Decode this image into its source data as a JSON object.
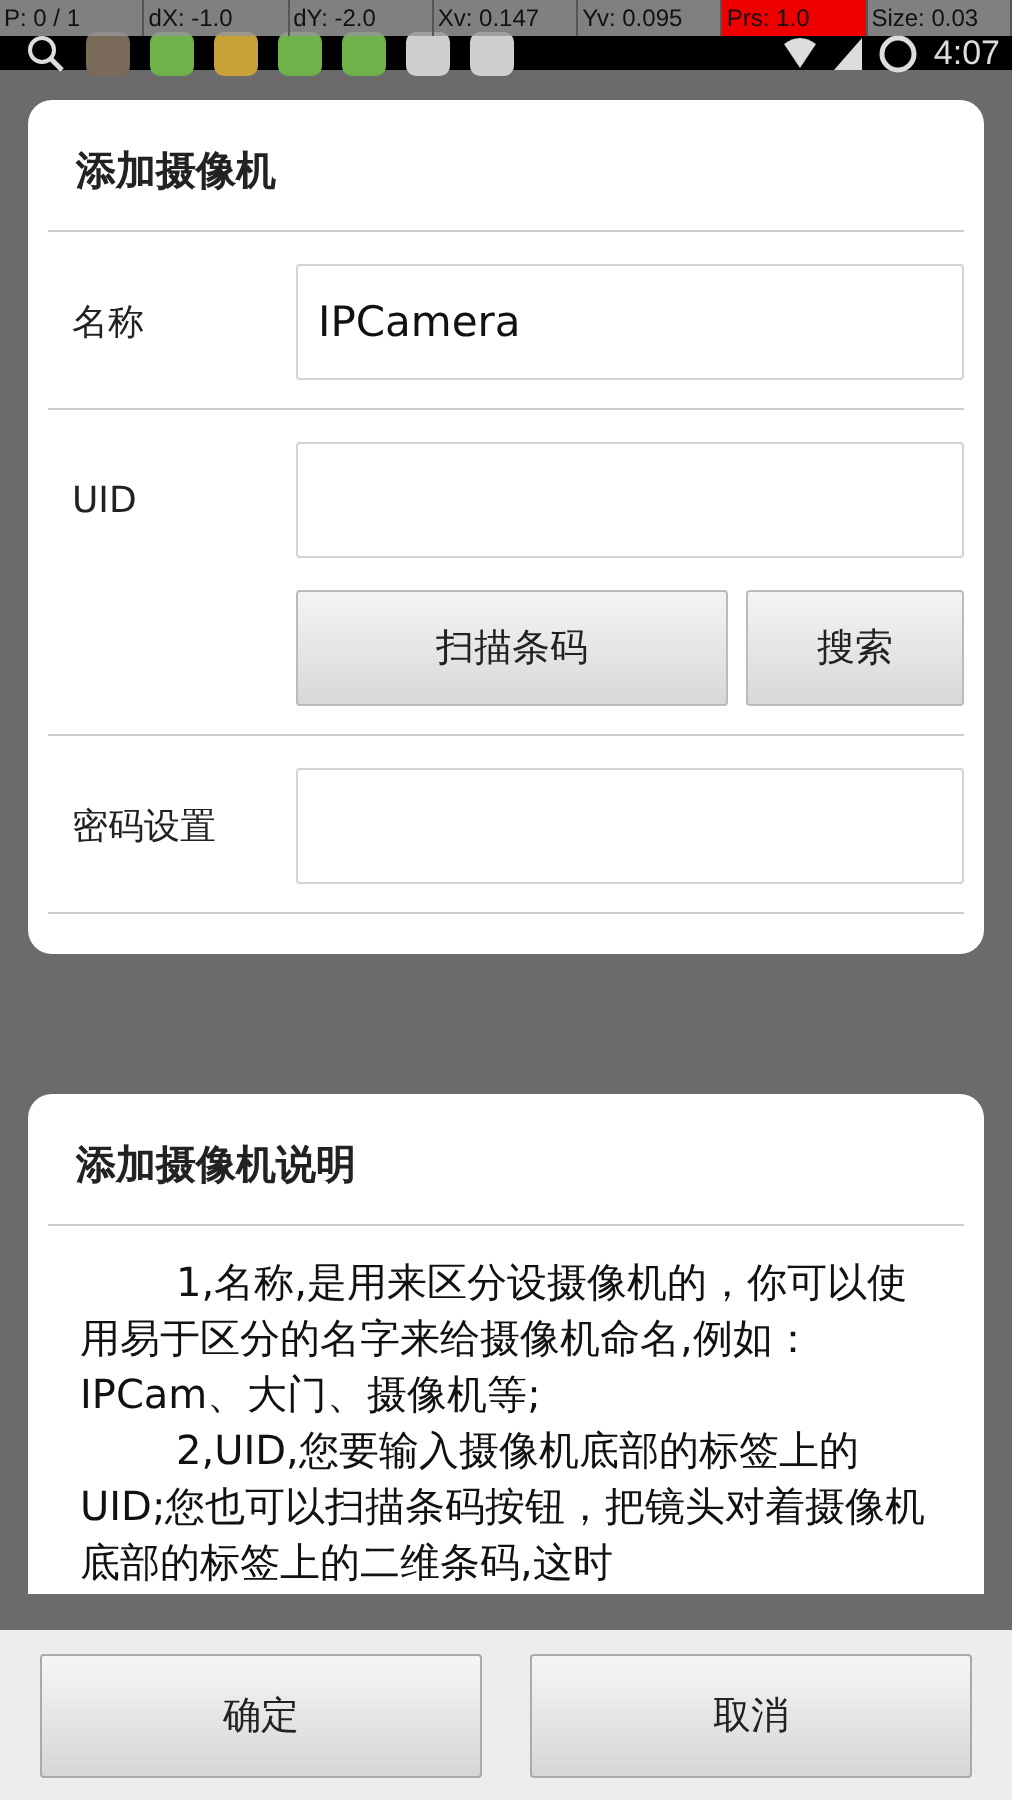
{
  "status_bar": {
    "pointer_overlay": [
      {
        "text": "P: 0 / 1",
        "highlighted": false
      },
      {
        "text": "dX: -1.0",
        "highlighted": false
      },
      {
        "text": "dY: -2.0",
        "highlighted": false
      },
      {
        "text": "Xv: 0.147",
        "highlighted": false
      },
      {
        "text": "Yv: 0.095",
        "highlighted": false
      },
      {
        "text": "Prs: 1.0",
        "highlighted": true
      },
      {
        "text": "Size: 0.03",
        "highlighted": false
      }
    ],
    "time": "4:07"
  },
  "form": {
    "title": "添加摄像机",
    "fields": [
      {
        "label": "名称",
        "value": "IPCamera"
      },
      {
        "label": "UID",
        "buttons": [
          "扫描条码",
          "搜索"
        ]
      },
      {
        "label": "密码设置"
      }
    ]
  },
  "help": {
    "title": "添加摄像机说明",
    "paragraphs": [
      "1,名称,是用来区分设摄像机的，你可以使用易于区分的名字来给摄像机命名,例如：IPCam、大门、摄像机等;",
      "2,UID,您要输入摄像机底部的标签上的UID;您也可以扫描条码按钮，把镜头对着摄像机底部的标签上的二维条码,这时"
    ]
  },
  "buttons": [
    "确定",
    "取消"
  ]
}
